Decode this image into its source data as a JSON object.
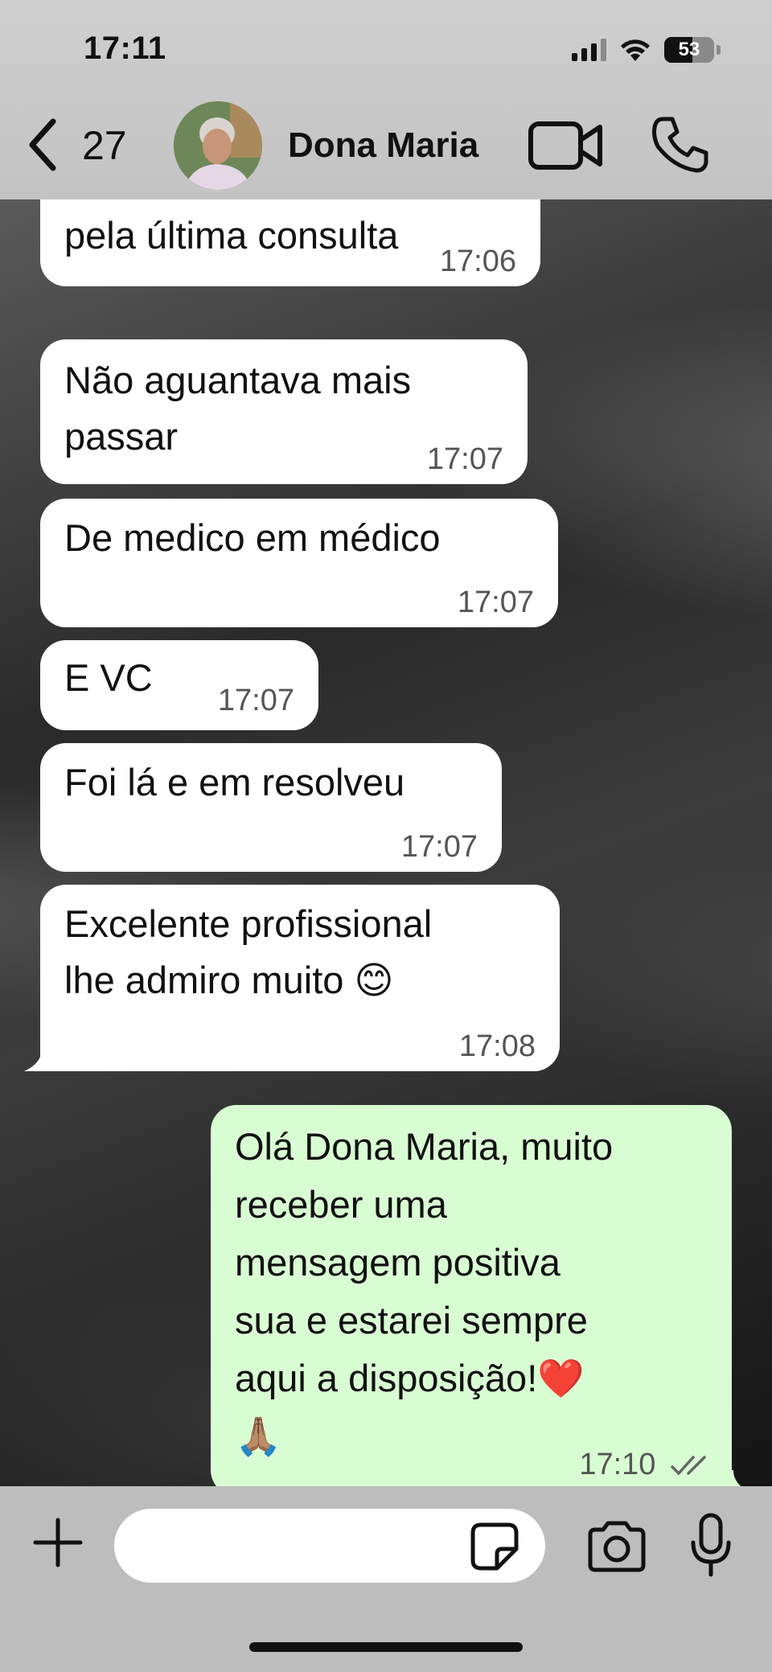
{
  "status_bar": {
    "time": "17:11",
    "battery": "53"
  },
  "header": {
    "back_count": "27",
    "contact_name": "Dona Maria"
  },
  "messages": [
    {
      "direction": "in",
      "lines": [
        "pela última consulta"
      ],
      "time": "17:06"
    },
    {
      "direction": "in",
      "lines": [
        "Não aguantava mais",
        "passar"
      ],
      "time": "17:07"
    },
    {
      "direction": "in",
      "lines": [
        "De medico em médico"
      ],
      "time": "17:07"
    },
    {
      "direction": "in",
      "lines": [
        "E VC"
      ],
      "time": "17:07"
    },
    {
      "direction": "in",
      "lines": [
        "Foi lá e em resolveu"
      ],
      "time": "17:07"
    },
    {
      "direction": "in",
      "lines": [
        "Excelente profissional",
        "lhe admiro muito 😊"
      ],
      "time": "17:08"
    },
    {
      "direction": "out",
      "lines": [
        "Olá Dona Maria, muito",
        "receber uma",
        "mensagem positiva",
        "sua e estarei sempre",
        "aqui a disposição!❤️",
        "🙏🏽"
      ],
      "time": "17:10"
    }
  ],
  "composer": {
    "input_value": "",
    "input_placeholder": ""
  },
  "colors": {
    "incoming_bubble": "#ffffff",
    "outgoing_bubble": "#d9fdd3",
    "header_bg": "#c8c8c8"
  },
  "icons": [
    "chevron-left-icon",
    "video-camera-icon",
    "phone-icon",
    "plus-icon",
    "sticker-icon",
    "camera-icon",
    "microphone-icon",
    "double-check-icon",
    "wifi-icon",
    "signal-icon",
    "battery-icon"
  ]
}
